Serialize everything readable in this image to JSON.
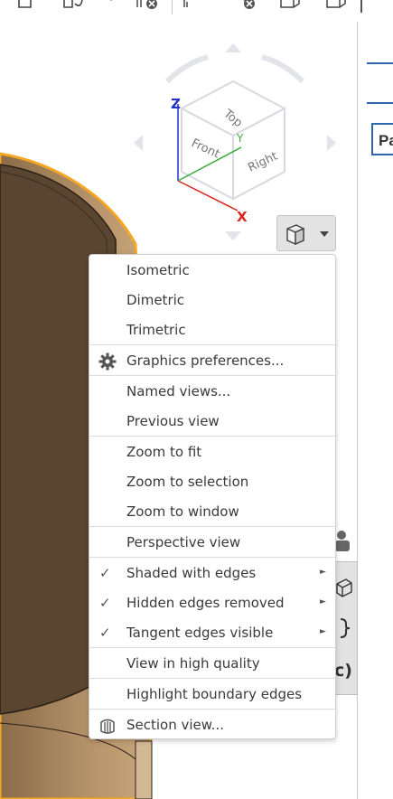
{
  "toolbar": {
    "icons": [
      "extrude-icon",
      "revolve-icon",
      "dropdown-caret-icon",
      "delete-face-icon",
      "fillet-icon",
      "delete-edge-icon",
      "boolean-icon",
      "shell-icon",
      "more-icon"
    ]
  },
  "viewcube": {
    "axes": {
      "z": "Z",
      "y": "Y",
      "x": "X"
    },
    "faces": {
      "top": "Top",
      "front": "Front",
      "right": "Right"
    }
  },
  "right_panel": {
    "field_text": "Pa",
    "side_text": "c)"
  },
  "view_menu": {
    "items": [
      {
        "label": "Isometric",
        "checked": false
      },
      {
        "label": "Dimetric",
        "checked": false
      },
      {
        "label": "Trimetric",
        "checked": false
      },
      {
        "label": "Graphics preferences...",
        "icon": "gear-icon"
      },
      {
        "label": "Named views..."
      },
      {
        "label": "Previous view"
      },
      {
        "label": "Zoom to fit"
      },
      {
        "label": "Zoom to selection"
      },
      {
        "label": "Zoom to window"
      },
      {
        "label": "Perspective view",
        "checked": false
      },
      {
        "label": "Shaded with edges",
        "checked": true,
        "submenu": true
      },
      {
        "label": "Hidden edges removed",
        "checked": true,
        "submenu": true
      },
      {
        "label": "Tangent edges visible",
        "checked": true,
        "submenu": true
      },
      {
        "label": "View in high quality"
      },
      {
        "label": "Highlight boundary edges"
      },
      {
        "label": "Section view...",
        "icon": "section-view-icon"
      }
    ],
    "check_glyph": "✓",
    "submenu_glyph": "►"
  },
  "colors": {
    "part_fill": "#b18e63",
    "part_inner": "#5a4630",
    "selection_edge": "#f5a623",
    "accent_blue": "#2d66ad",
    "axis_x": "#d9261c",
    "axis_y": "#3caa3c",
    "axis_z": "#2231c9"
  }
}
